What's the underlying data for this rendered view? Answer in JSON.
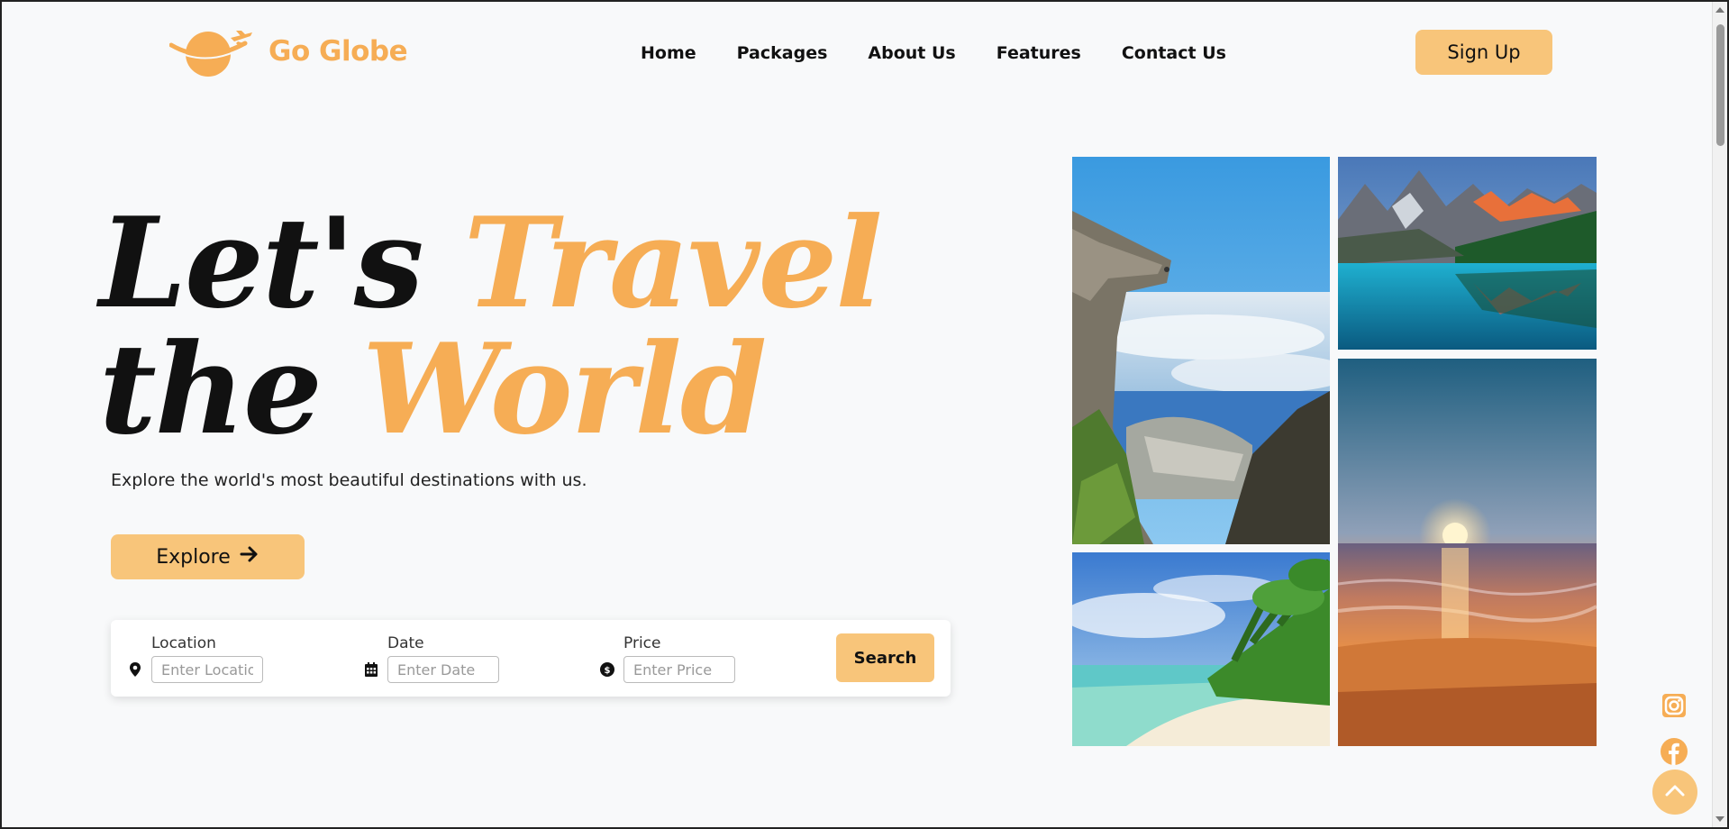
{
  "brand": {
    "name": "Go Globe",
    "logo_icon": "globe-plane-icon",
    "color": "#f6ad55"
  },
  "nav": {
    "links": [
      {
        "label": "Home"
      },
      {
        "label": "Packages"
      },
      {
        "label": "About Us"
      },
      {
        "label": "Features"
      },
      {
        "label": "Contact Us"
      }
    ],
    "signup_label": "Sign Up"
  },
  "hero": {
    "title_line1_a": "Let's",
    "title_line1_b": "Travel",
    "title_line2_a": "the",
    "title_line2_b": "World",
    "subtitle": "Explore the world's most beautiful destinations with us.",
    "explore_label": "Explore",
    "explore_icon": "arrow-right-icon"
  },
  "search": {
    "location": {
      "label": "Location",
      "placeholder": "Enter Location",
      "value": "",
      "icon": "map-pin-icon"
    },
    "date": {
      "label": "Date",
      "placeholder": "Enter Date",
      "value": "",
      "icon": "calendar-icon"
    },
    "price": {
      "label": "Price",
      "placeholder": "Enter Price",
      "value": "",
      "icon": "dollar-circle-icon"
    },
    "button_label": "Search"
  },
  "gallery": [
    {
      "subject": "cliff overlooking clouds and city"
    },
    {
      "subject": "mountain lake at sunrise"
    },
    {
      "subject": "tropical beach with palm trees"
    },
    {
      "subject": "ocean sunset over beach"
    }
  ],
  "social": [
    {
      "icon": "instagram-icon"
    },
    {
      "icon": "facebook-icon"
    }
  ],
  "scroll_top_icon": "chevron-up-icon",
  "colors": {
    "accent": "#f6ad55",
    "button": "#f8c57a",
    "background": "#f8f9fa"
  }
}
